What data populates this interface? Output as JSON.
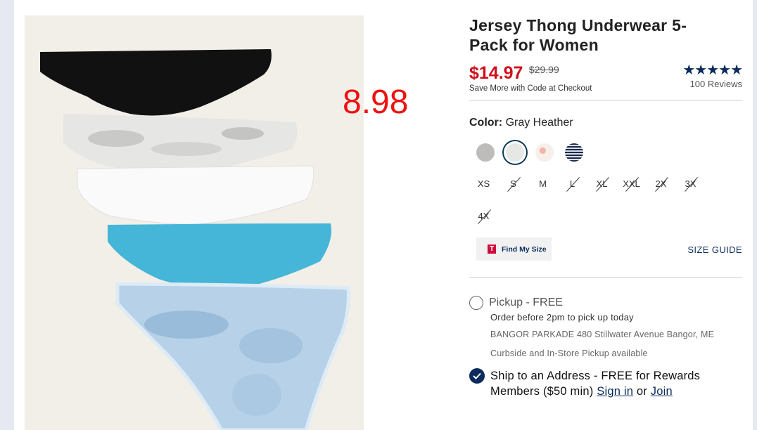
{
  "product": {
    "title": "Jersey Thong Underwear 5-Pack for Women",
    "price": "$14.97",
    "old_price": "$29.99",
    "promo": "Save More with Code at Checkout",
    "stars": "★★★★★",
    "reviews": "100 Reviews",
    "rating": 4.6
  },
  "annotation": "8.98",
  "color": {
    "label": "Color:",
    "value": "Gray Heather",
    "swatches": [
      {
        "name": "Heather Gray",
        "color": "#bdbcba"
      },
      {
        "name": "Gray Heather",
        "color": "#e7e8e6"
      },
      {
        "name": "Floral",
        "color": "#f3e6e0"
      },
      {
        "name": "Stripe",
        "color": "#8b97ad"
      }
    ]
  },
  "sizes": [
    {
      "label": "XS",
      "available": true
    },
    {
      "label": "S",
      "available": false
    },
    {
      "label": "M",
      "available": true
    },
    {
      "label": "L",
      "available": false
    },
    {
      "label": "XL",
      "available": false
    },
    {
      "label": "XXL",
      "available": false
    },
    {
      "label": "2X",
      "available": false
    },
    {
      "label": "3X",
      "available": false
    },
    {
      "label": "4X",
      "available": false
    }
  ],
  "find_size": {
    "logo": "T",
    "label": "Find My Size"
  },
  "size_guide": "SIZE GUIDE",
  "pickup": {
    "label": "Pickup - FREE",
    "line1": "Order before 2pm to pick up today",
    "line2": "BANGOR PARKADE 480 Stillwater Avenue  Bangor, ME",
    "line3": "Curbside and In-Store Pickup available"
  },
  "ship": {
    "label": "Ship to an Address - FREE for Rewards Members ($50 min)",
    "sign_in": "Sign in",
    "or": "or",
    "join": "Join"
  },
  "colors": {
    "sale": "#d0101b",
    "navy": "#0a2b5c"
  }
}
